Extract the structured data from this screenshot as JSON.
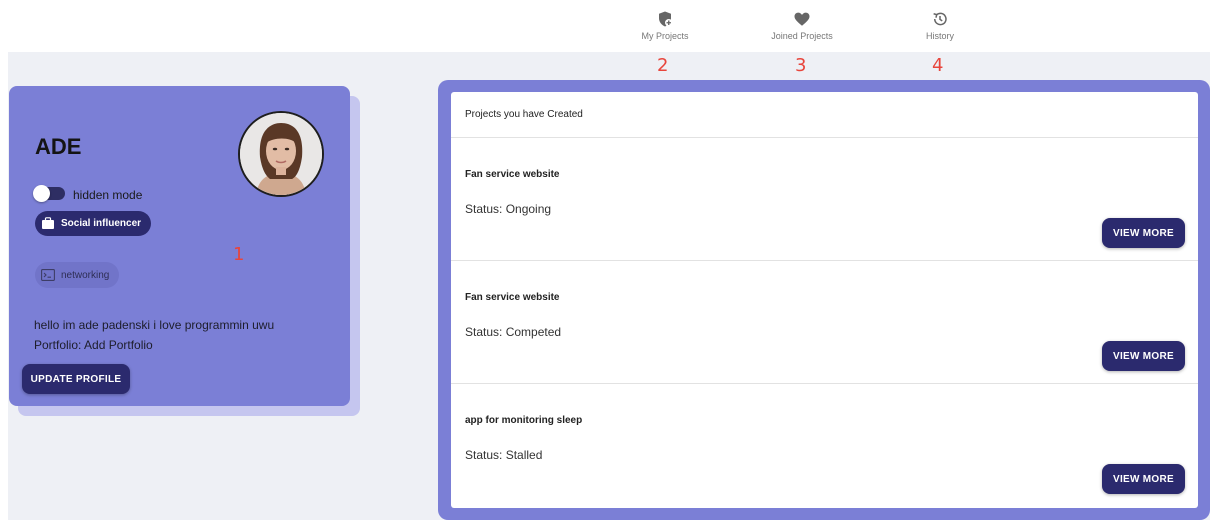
{
  "nav": {
    "items": [
      {
        "label": "My Projects",
        "icon": "shield-plus-icon",
        "annotation": "2"
      },
      {
        "label": "Joined Projects",
        "icon": "heart-icon",
        "annotation": "3"
      },
      {
        "label": "History",
        "icon": "history-icon",
        "annotation": "4"
      }
    ]
  },
  "profile": {
    "name": "ADE",
    "hidden_mode_label": "hidden mode",
    "hidden_mode_on": false,
    "role_chip": "Social influencer",
    "skill_chip": "networking",
    "annotation": "1",
    "bio": "hello im ade padenski i love programmin uwu",
    "portfolio": "Portfolio: Add Portfolio",
    "update_button": "UPDATE PROFILE"
  },
  "projects": {
    "header": "Projects you have Created",
    "view_more_label": "VIEW MORE",
    "items": [
      {
        "title": "Fan service website",
        "status": "Status: Ongoing"
      },
      {
        "title": "Fan service website",
        "status": "Status: Competed"
      },
      {
        "title": "app for monitoring sleep",
        "status": "Status: Stalled"
      }
    ]
  },
  "colors": {
    "panel": "#7b7fd6",
    "primary_dark": "#2b2a6e",
    "annotation": "#e8453c",
    "background": "#eef0f5"
  }
}
